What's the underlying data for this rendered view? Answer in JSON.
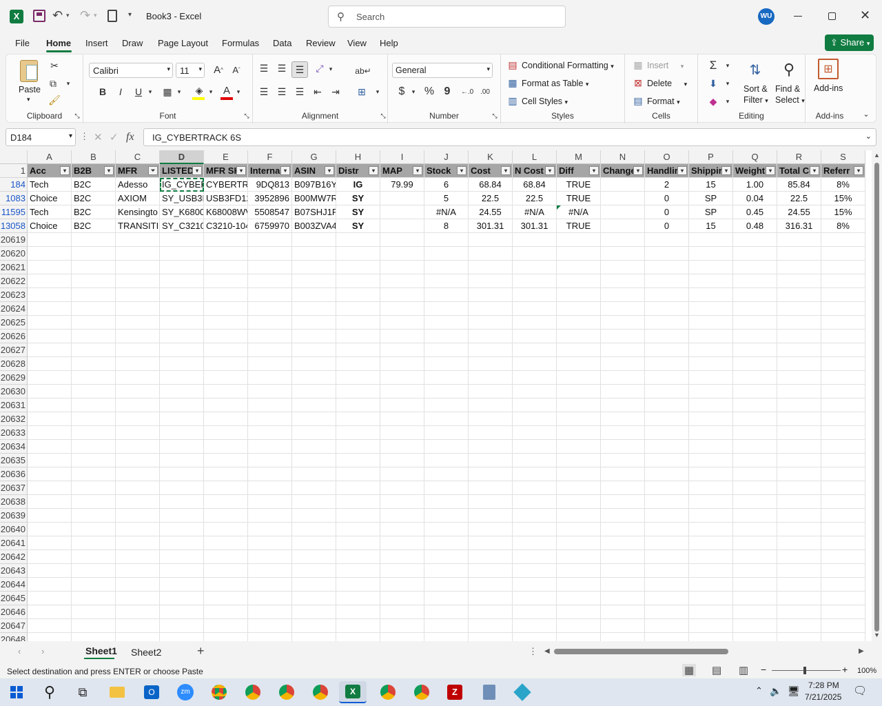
{
  "title_bar": {
    "doc_title": "Book3 - Excel",
    "search_placeholder": "Search",
    "avatar": "WU"
  },
  "tabs": [
    "File",
    "Home",
    "Insert",
    "Draw",
    "Page Layout",
    "Formulas",
    "Data",
    "Review",
    "View",
    "Help"
  ],
  "share_label": "Share",
  "ribbon": {
    "clipboard": {
      "paste": "Paste",
      "label": "Clipboard"
    },
    "font": {
      "name": "Calibri",
      "size": "11",
      "label": "Font",
      "bold": "B",
      "italic": "I",
      "underline": "U"
    },
    "alignment": {
      "label": "Alignment"
    },
    "number": {
      "format": "General",
      "label": "Number",
      "currency": "$",
      "percent": "%",
      "comma": "9"
    },
    "styles": {
      "conditional": "Conditional Formatting",
      "format_table": "Format as Table",
      "cell_styles": "Cell Styles",
      "label": "Styles"
    },
    "cells": {
      "insert": "Insert",
      "delete": "Delete",
      "format": "Format",
      "label": "Cells"
    },
    "editing": {
      "sort": "Sort &",
      "filter": "Filter",
      "find": "Find &",
      "select": "Select",
      "label": "Editing"
    },
    "addins": {
      "addins": "Add-ins",
      "label": "Add-ins"
    }
  },
  "formula_bar": {
    "name_box": "D184",
    "content": "IG_CYBERTRACK 6S",
    "fx": "fx"
  },
  "grid": {
    "columns": [
      "A",
      "B",
      "C",
      "D",
      "E",
      "F",
      "G",
      "H",
      "I",
      "J",
      "K",
      "L",
      "M",
      "N",
      "O",
      "P",
      "Q",
      "R",
      "S"
    ],
    "header_row_num": "1",
    "headers": [
      "Acc",
      "B2B",
      "MFR",
      "LISTED",
      "MFR SK",
      "Interna",
      "ASIN",
      "Distr",
      "MAP",
      "Stock",
      "Cost",
      "N Cost",
      "Diff",
      "Change",
      "Handlir",
      "Shippir",
      "Weight",
      "Total Co",
      "Referr"
    ],
    "rows": [
      {
        "num": "184",
        "cells": [
          "Tech",
          "B2C",
          "Adesso",
          "IG_CYBERT",
          "CYBERTRA",
          "9DQ813",
          "B097B16Y7",
          "IG",
          "79.99",
          "6",
          "68.84",
          "68.84",
          "TRUE",
          "",
          "2",
          "15",
          "1.00",
          "85.84",
          "8%"
        ]
      },
      {
        "num": "1083",
        "cells": [
          "Choice",
          "B2C",
          "AXIOM",
          "SY_USB3FI",
          "USB3FD12",
          "3952896",
          "B00MW7R",
          "SY",
          "",
          "5",
          "22.5",
          "22.5",
          "TRUE",
          "",
          "0",
          "SP",
          "0.04",
          "22.5",
          "15%"
        ]
      },
      {
        "num": "11595",
        "cells": [
          "Tech",
          "B2C",
          "Kensingto",
          "SY_K68008",
          "K68008WV",
          "5508547",
          "B07SHJ1R",
          "SY",
          "",
          "#N/A",
          "24.55",
          "#N/A",
          "#N/A",
          "",
          "0",
          "SP",
          "0.45",
          "24.55",
          "15%"
        ]
      },
      {
        "num": "13058",
        "cells": [
          "Choice",
          "B2C",
          "TRANSITIC",
          "SY_C3210-",
          "C3210-104",
          "6759970",
          "B003ZVA4",
          "SY",
          "",
          "8",
          "301.31",
          "301.31",
          "TRUE",
          "",
          "0",
          "15",
          "0.48",
          "316.31",
          "8%"
        ]
      }
    ],
    "empty_rows": [
      "20619",
      "20620",
      "20621",
      "20622",
      "20623",
      "20624",
      "20625",
      "20626",
      "20627",
      "20628",
      "20629",
      "20630",
      "20631",
      "20632",
      "20633",
      "20634",
      "20635",
      "20636",
      "20637",
      "20638",
      "20639",
      "20640",
      "20641",
      "20642",
      "20643",
      "20644",
      "20645",
      "20646",
      "20647",
      "20648"
    ]
  },
  "sheets": [
    "Sheet1",
    "Sheet2"
  ],
  "status": {
    "message": "Select destination and press ENTER or choose Paste",
    "zoom": "100%"
  },
  "taskbar": {
    "time": "7:28 PM",
    "date": "7/21/2025"
  }
}
